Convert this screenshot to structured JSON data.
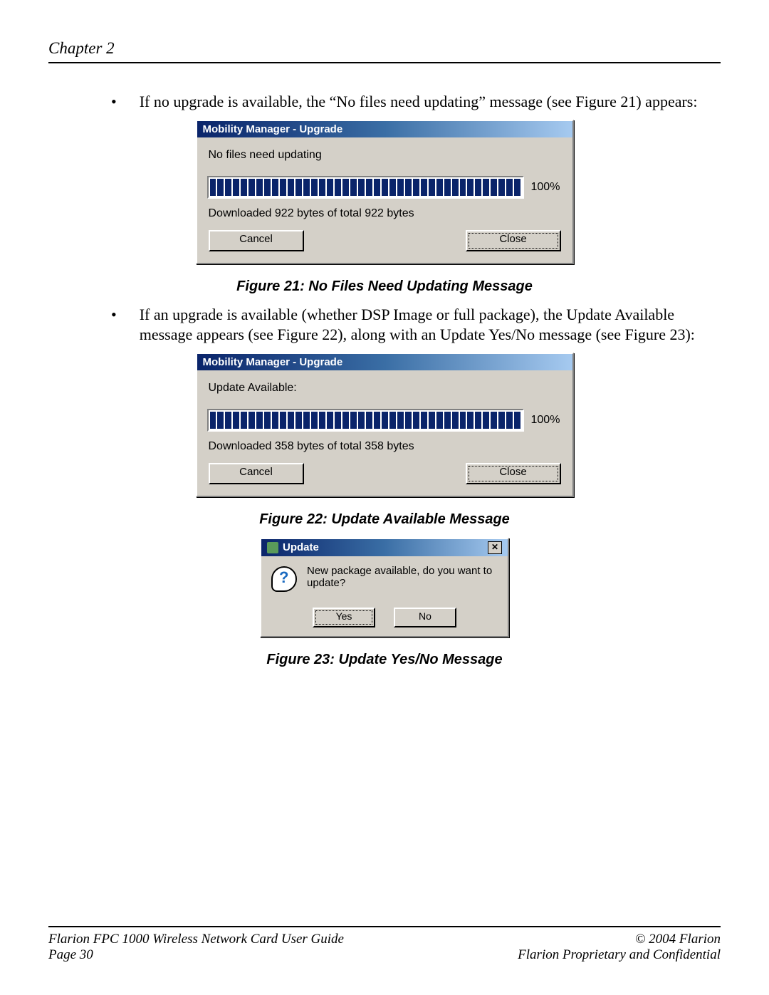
{
  "header": {
    "chapter": "Chapter 2"
  },
  "bullets": {
    "b1": "If no upgrade is available, the “No files need updating” message (see Figure 21) appears:",
    "b2": "If an upgrade is available (whether DSP Image or full package), the Update Available message appears (see Figure 22), along with an Update Yes/No message (see Figure 23):"
  },
  "captions": {
    "fig21": "Figure 21: No Files Need Updating Message",
    "fig22": "Figure 22: Update Available Message",
    "fig23": "Figure 23: Update Yes/No Message"
  },
  "dlg1": {
    "title": "Mobility Manager - Upgrade",
    "message": "No files need updating",
    "percent": "100%",
    "status": "Downloaded 922 bytes of total 922 bytes",
    "cancel": "Cancel",
    "close": "Close"
  },
  "dlg2": {
    "title": "Mobility Manager - Upgrade",
    "message": "Update Available:",
    "percent": "100%",
    "status": "Downloaded 358 bytes of total 358 bytes",
    "cancel": "Cancel",
    "close": "Close"
  },
  "dlg3": {
    "title": "Update",
    "message": "New package available, do you want to update?",
    "yes": "Yes",
    "no": "No",
    "x": "✕"
  },
  "footer": {
    "guide": "Flarion FPC 1000 Wireless Network Card User Guide",
    "copyright": "© 2004 Flarion",
    "page": "Page 30",
    "confidential": "Flarion Proprietary and Confidential"
  }
}
